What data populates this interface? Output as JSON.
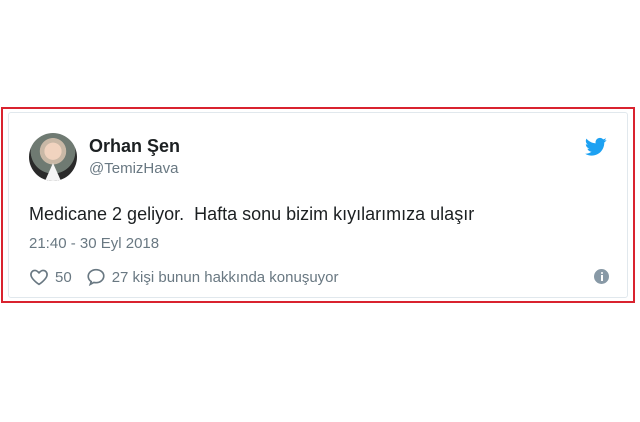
{
  "tweet": {
    "author_name": "Orhan Şen",
    "author_handle": "@TemizHava",
    "text": "Medicane 2 geliyor.  Hafta sonu bizim kıyılarımıza ulaşır",
    "timestamp": "21:40 - 30 Eyl 2018",
    "likes": "50",
    "comments_text": "27 kişi bunun hakkında konuşuyor"
  },
  "colors": {
    "frame_border": "#d9232f",
    "twitter_blue": "#1da1f2",
    "secondary_text": "#697882"
  },
  "icons": {
    "brand": "twitter-bird-icon",
    "like": "heart-icon",
    "comment": "speech-bubble-icon",
    "info": "info-icon"
  }
}
